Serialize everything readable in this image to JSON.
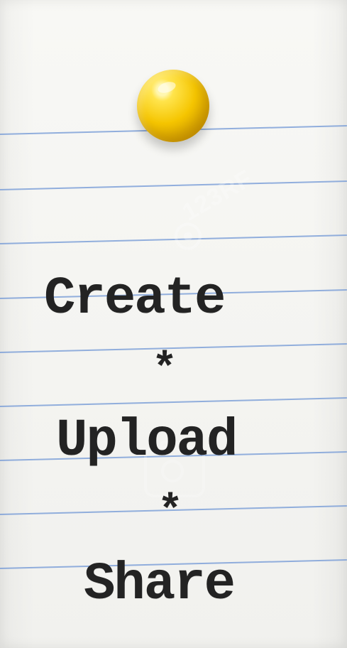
{
  "note": {
    "lines": [
      "Create",
      "*",
      "Upload",
      "*",
      "Share"
    ]
  },
  "watermarks": {
    "top": "123RF"
  },
  "colors": {
    "paper": "#f4f4f1",
    "rule": "#759ad6",
    "pin": "#f5c500",
    "text": "#232323",
    "background": "#d8b57c"
  },
  "icons": {
    "pin": "push-pin-icon",
    "watermark_top_logo": "watermark-logo-icon",
    "watermark_camera": "camera-icon"
  }
}
